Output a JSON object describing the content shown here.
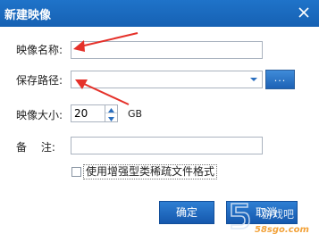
{
  "dialog": {
    "title": "新建映像",
    "close_label": "×"
  },
  "form": {
    "name_label": "映像名称:",
    "name_value": "",
    "path_label": "保存路径:",
    "path_value": "",
    "browse_label": "...",
    "size_label": "映像大小:",
    "size_value": "20",
    "size_unit": "GB",
    "note_label": "备　 注:",
    "note_value": "",
    "sparse_checkbox_label": "使用增强型类稀疏文件格式",
    "sparse_checked": false
  },
  "buttons": {
    "ok_label": "确定",
    "cancel_label": "取消"
  },
  "overlay": {
    "arrow_color": "#e5312a",
    "watermark_site": "58sgo.com",
    "watermark_brand": "5 游戏吧"
  },
  "colors": {
    "titlebar": "#1a68bd",
    "button": "#1f6cc2"
  }
}
